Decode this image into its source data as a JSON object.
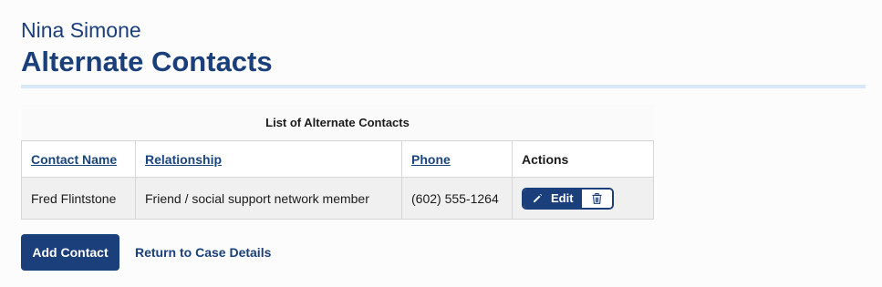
{
  "header": {
    "person_name": "Nina Simone",
    "page_title": "Alternate Contacts"
  },
  "contacts_table": {
    "caption": "List of Alternate Contacts",
    "columns": {
      "contact_name": "Contact Name",
      "relationship": "Relationship",
      "phone": "Phone",
      "actions": "Actions"
    },
    "rows": [
      {
        "contact_name": "Fred Flintstone",
        "relationship": "Friend / social support network member",
        "phone": "(602) 555-1264",
        "edit_label": "Edit"
      }
    ]
  },
  "footer": {
    "add_contact_label": "Add Contact",
    "return_label": "Return to Case Details"
  },
  "colors": {
    "primary": "#1a3f7a",
    "link": "#1a4480",
    "rule": "#d9e8f6"
  },
  "icons": {
    "edit": "pencil-icon",
    "delete": "trash-icon"
  }
}
